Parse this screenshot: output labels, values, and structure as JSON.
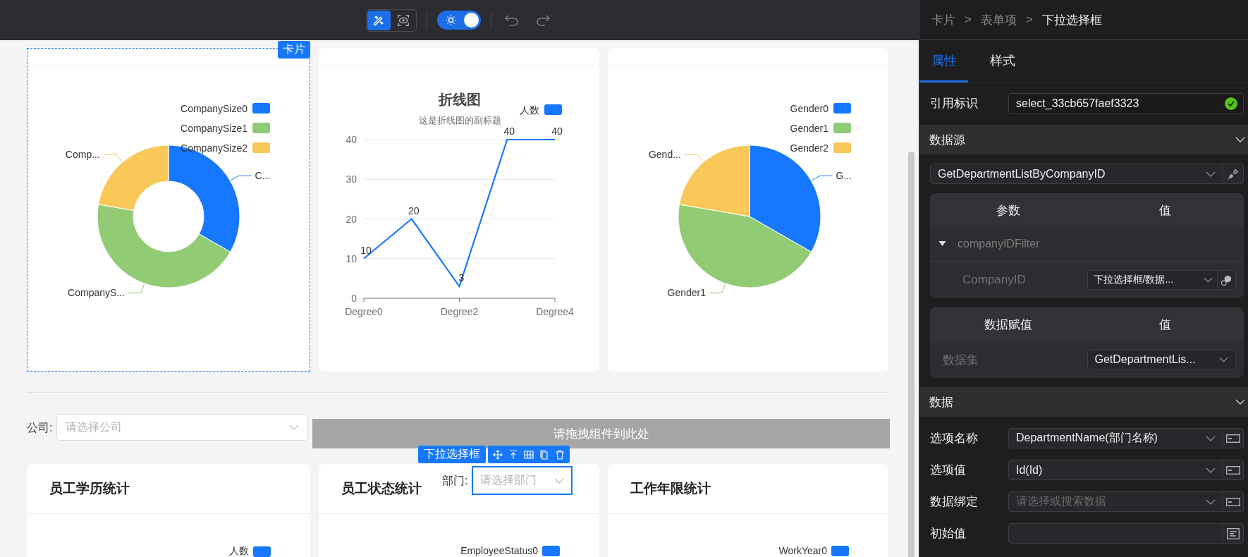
{
  "toolbar": {
    "modes": [
      {
        "kind": "design",
        "selected": true
      },
      {
        "kind": "preview",
        "selected": false
      }
    ],
    "theme_toggle": {
      "on": true
    },
    "history": [
      {
        "kind": "undo",
        "disabled": true
      },
      {
        "kind": "redo",
        "disabled": true
      }
    ]
  },
  "canvas": {
    "chart_cards": [
      {
        "kind": "donut",
        "selected": true,
        "tag": "卡片",
        "slices": [
          {
            "legend": "CompanySize0",
            "label": "C...",
            "color": "#1677ff"
          },
          {
            "legend": "CompanySize1",
            "label": "CompanyS...",
            "color": "#91cb74"
          },
          {
            "legend": "CompanySize2",
            "label": "Comp...",
            "color": "#fac858"
          }
        ]
      },
      {
        "kind": "line",
        "selected": false,
        "subtitle": "这是折线图的副标题",
        "chart_data": {
          "type": "line",
          "title": "折线图",
          "categories": [
            "Degree0",
            null,
            "Degree2",
            null,
            "Degree4"
          ],
          "ylim": [
            0,
            40
          ],
          "yticks": [
            0,
            10,
            20,
            30,
            40
          ],
          "data_labels": true,
          "grid": true,
          "series": [
            {
              "name": "人数",
              "color": "#1677ff",
              "values": [
                10,
                20,
                3,
                40,
                40
              ]
            }
          ]
        }
      },
      {
        "kind": "pie",
        "selected": false,
        "slices": [
          {
            "legend": "Gender0",
            "label": "G...",
            "color": "#1677ff"
          },
          {
            "legend": "Gender1",
            "label": "Gender1",
            "color": "#91cb74"
          },
          {
            "legend": "Gender2",
            "label": "Gend...",
            "color": "#fac858"
          }
        ]
      }
    ],
    "filter": {
      "label": "公司:",
      "placeholder": "请选择公司"
    },
    "drop_zone": {
      "text": "请拖拽组件到此处"
    },
    "selected_component": {
      "tag": "下拉选择框",
      "label": "部门:",
      "placeholder": "请选择部门"
    },
    "stat_cards": [
      {
        "title": "员工学历统计",
        "legend": {
          "label": "人数",
          "color": "#1677ff"
        }
      },
      {
        "title": "员工状态统计",
        "legend": {
          "label": "EmployeeStatus0",
          "color": "#1677ff"
        }
      },
      {
        "title": "工作年限统计",
        "legend": {
          "label": "WorkYear0",
          "color": "#1677ff"
        }
      }
    ]
  },
  "panel": {
    "breadcrumb": [
      {
        "kind": "link",
        "text": "卡片"
      },
      {
        "kind": "sep",
        "text": ">"
      },
      {
        "kind": "link",
        "text": "表单项"
      },
      {
        "kind": "sep",
        "text": ">"
      },
      {
        "kind": "current",
        "text": "下拉选择框"
      }
    ],
    "tabs": [
      {
        "label": "属性",
        "selected": true
      },
      {
        "label": "样式",
        "selected": false
      }
    ],
    "ref": {
      "label": "引用标识",
      "value": "select_33cb657faef3323",
      "valid": true
    },
    "source_section": {
      "title": "数据源",
      "expanded": true,
      "source": "GetDepartmentListByCompanyID",
      "params": {
        "headers": [
          "参数",
          "值"
        ],
        "groups": [
          {
            "name": "companyIDFilter",
            "expanded": true,
            "rows": [
              {
                "name": "CompanyID",
                "value": "下拉选择框/数据..."
              }
            ]
          }
        ]
      },
      "assign": {
        "headers": [
          "数据赋值",
          "值"
        ],
        "rows": [
          {
            "name": "数据集",
            "value": "GetDepartmentLis..."
          }
        ]
      }
    },
    "data_section": {
      "title": "数据",
      "expanded": true,
      "fields": [
        {
          "kind": "select",
          "label": "选项名称",
          "value": "DepartmentName(部门名称)"
        },
        {
          "kind": "select",
          "label": "选项值",
          "value": "Id(Id)"
        },
        {
          "kind": "select",
          "label": "数据绑定",
          "placeholder": "请选择或搜索数据"
        },
        {
          "kind": "text",
          "label": "初始值"
        }
      ]
    }
  }
}
